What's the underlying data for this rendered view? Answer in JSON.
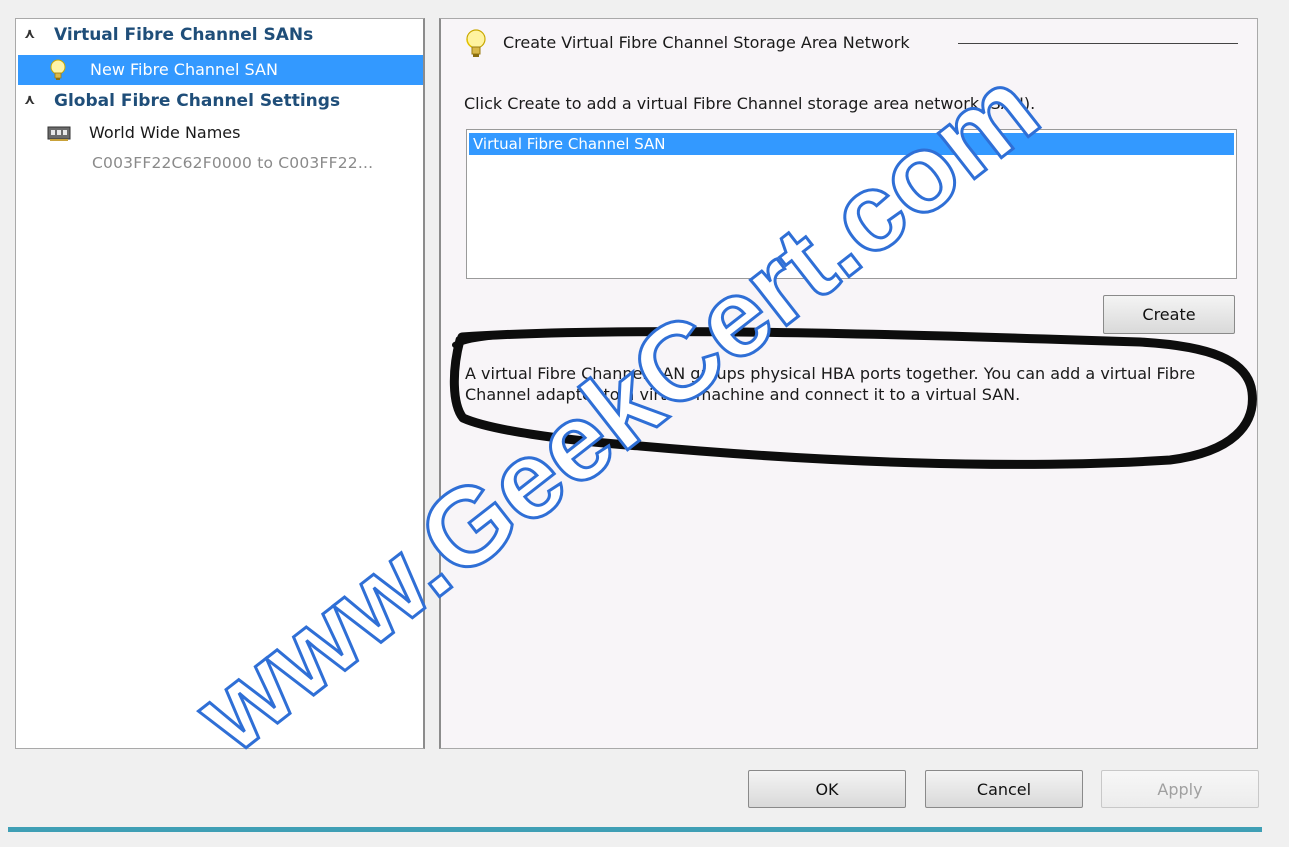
{
  "nav": {
    "header_sans": "Virtual Fibre Channel SANs",
    "selected_item": "New Fibre Channel SAN",
    "header_global": "Global Fibre Channel Settings",
    "wwn_label": "World Wide Names",
    "wwn_range": "C003FF22C62F0000 to C003FF22..."
  },
  "content": {
    "group_title": "Create Virtual Fibre Channel Storage Area Network",
    "instruction": "Click Create to add a virtual Fibre Channel storage area network (SAN).",
    "list_items": [
      "Virtual Fibre Channel SAN"
    ],
    "create_label": "Create",
    "description": "A virtual Fibre Channel SAN groups physical HBA ports together. You can add a virtual Fibre Channel adapter to a virtual machine and connect it to a virtual SAN."
  },
  "footer": {
    "ok_label": "OK",
    "cancel_label": "Cancel",
    "apply_label": "Apply"
  },
  "watermark": "www.GeekCert.com",
  "colors": {
    "selection": "#3399ff",
    "header_text": "#1f4e79",
    "watermark_fill": "#ffffff",
    "watermark_stroke": "#2f6fd6",
    "accent_rule": "#3f9fb5"
  },
  "icons": {
    "collapse": "double-chevron-up-icon",
    "san": "lightbulb-icon",
    "wwn": "network-card-icon"
  }
}
